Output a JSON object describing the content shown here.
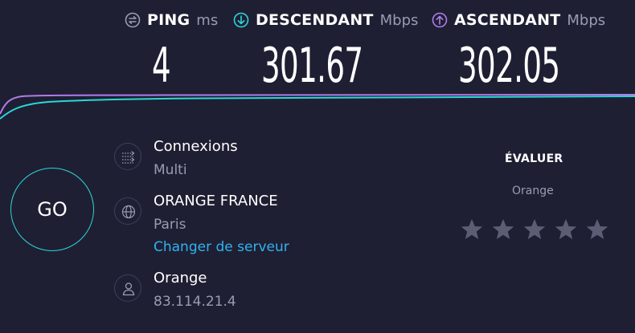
{
  "metrics": {
    "ping": {
      "label": "PING",
      "unit": "ms",
      "value": "4"
    },
    "download": {
      "label": "DESCENDANT",
      "unit": "Mbps",
      "value": "301.67"
    },
    "upload": {
      "label": "ASCENDANT",
      "unit": "Mbps",
      "value": "302.05"
    }
  },
  "colors": {
    "background": "#1f1f33",
    "download_accent": "#2ad7d7",
    "upload_accent": "#b07ce8",
    "link": "#2fb3f0",
    "muted": "#9a9bb2"
  },
  "go_button": {
    "label": "GO"
  },
  "connections": {
    "title": "Connexions",
    "value": "Multi",
    "icon": "connections-icon"
  },
  "server": {
    "title": "ORANGE FRANCE",
    "location": "Paris",
    "change_link": "Changer de serveur",
    "icon": "globe-icon"
  },
  "provider": {
    "title": "Orange",
    "ip": "83.114.21.4",
    "icon": "user-icon"
  },
  "rating": {
    "title": "ÉVALUER",
    "isp": "Orange",
    "stars_total": 5,
    "stars_selected": 0
  }
}
